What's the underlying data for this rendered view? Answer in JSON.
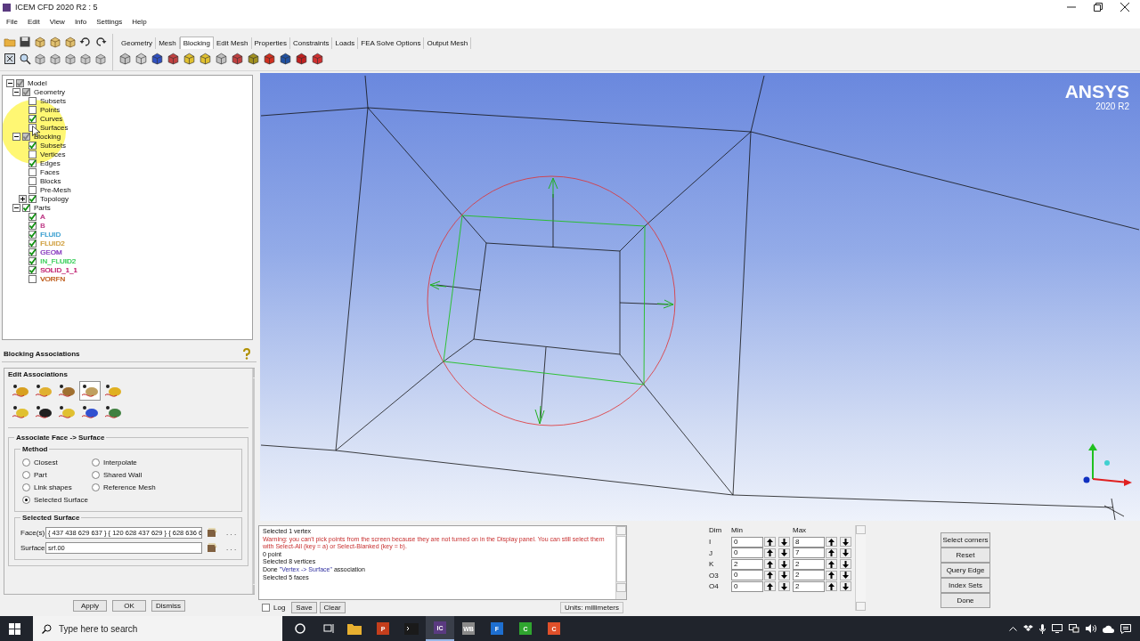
{
  "window": {
    "title": "ICEM CFD 2020 R2 : 5"
  },
  "menu": [
    "File",
    "Edit",
    "View",
    "Info",
    "Settings",
    "Help"
  ],
  "tabs": [
    {
      "label": "Geometry",
      "selected": false
    },
    {
      "label": "Mesh",
      "selected": false
    },
    {
      "label": "Blocking",
      "selected": true
    },
    {
      "label": "Edit Mesh",
      "selected": false
    },
    {
      "label": "Properties",
      "selected": false
    },
    {
      "label": "Constraints",
      "selected": false
    },
    {
      "label": "Loads",
      "selected": false
    },
    {
      "label": "FEA Solve Options",
      "selected": false
    },
    {
      "label": "Output Mesh",
      "selected": false
    }
  ],
  "tree": [
    {
      "label": "Model",
      "checked": true,
      "partial": true,
      "expanded": true,
      "children": [
        {
          "label": "Geometry",
          "checked": true,
          "partial": true,
          "expanded": true,
          "children": [
            {
              "label": "Subsets",
              "checked": false,
              "partial": false
            },
            {
              "label": "Points",
              "checked": false,
              "partial": false
            },
            {
              "label": "Curves",
              "checked": true,
              "partial": false
            },
            {
              "label": "Surfaces",
              "checked": false,
              "partial": false
            }
          ]
        },
        {
          "label": "Blocking",
          "checked": true,
          "partial": true,
          "expanded": true,
          "children": [
            {
              "label": "Subsets",
              "checked": true,
              "partial": false
            },
            {
              "label": "Vertices",
              "checked": false,
              "partial": false
            },
            {
              "label": "Edges",
              "checked": true,
              "partial": false
            },
            {
              "label": "Faces",
              "checked": false,
              "partial": false
            },
            {
              "label": "Blocks",
              "checked": false,
              "partial": false
            },
            {
              "label": "Pre-Mesh",
              "checked": false,
              "partial": false
            },
            {
              "label": "Topology",
              "checked": true,
              "partial": false,
              "expanded": false
            }
          ]
        },
        {
          "label": "Parts",
          "checked": true,
          "partial": false,
          "expanded": true,
          "children": [
            {
              "label": "A",
              "checked": true,
              "partial": false,
              "color": "#c0408a"
            },
            {
              "label": "B",
              "checked": true,
              "partial": false,
              "color": "#c0408a"
            },
            {
              "label": "FLUID",
              "checked": true,
              "partial": false,
              "color": "#3a9fd0"
            },
            {
              "label": "FLUID2",
              "checked": true,
              "partial": false,
              "color": "#d0a040"
            },
            {
              "label": "GEOM",
              "checked": true,
              "partial": false,
              "color": "#8a40c0"
            },
            {
              "label": "IN_FLUID2",
              "checked": true,
              "partial": false,
              "color": "#40d060"
            },
            {
              "label": "SOLID_1_1",
              "checked": true,
              "partial": false,
              "color": "#c02070"
            },
            {
              "label": "VORFN",
              "checked": false,
              "partial": false,
              "color": "#c06020"
            }
          ]
        }
      ]
    }
  ],
  "viewport": {
    "brand": "ANSYS",
    "version": "2020 R2"
  },
  "associations": {
    "title": "Blocking Associations",
    "group": "Edit Associations",
    "tools": [
      {
        "selected": false
      },
      {
        "selected": false
      },
      {
        "selected": false
      },
      {
        "selected": true
      },
      {
        "selected": false
      },
      {
        "selected": false
      },
      {
        "selected": false
      },
      {
        "selected": false
      },
      {
        "selected": false
      },
      {
        "selected": false
      }
    ],
    "section": "Associate Face -> Surface",
    "method_title": "Method",
    "methods": [
      {
        "label": "Closest",
        "selected": false
      },
      {
        "label": "Interpolate",
        "selected": false
      },
      {
        "label": "Part",
        "selected": false
      },
      {
        "label": "Shared Wall",
        "selected": false
      },
      {
        "label": "Link shapes",
        "selected": false
      },
      {
        "label": "Reference Mesh",
        "selected": false
      },
      {
        "label": "Selected Surface",
        "selected": true
      }
    ],
    "selected_title": "Selected Surface",
    "fields": [
      {
        "label": "Face(s)",
        "value": "{ 437 438 629 637 } { 120 628 437 629 } { 628 636 6",
        "more": ". . ."
      },
      {
        "label": "Surface",
        "value": "srf.00",
        "more": ". . ."
      }
    ],
    "buttons": [
      "Apply",
      "OK",
      "Dismiss"
    ]
  },
  "messages": {
    "lines": [
      {
        "segments": [
          {
            "text": "Selected 1 vertex",
            "kind": "normal"
          }
        ]
      },
      {
        "segments": [
          {
            "text": "Warning: you can't pick points from the screen because they are not turned on in the Display panel. You can still select them with Select-All (key = a) or Select-Blanked (key = b).",
            "kind": "warning"
          }
        ]
      },
      {
        "segments": [
          {
            "text": "0 point",
            "kind": "normal"
          }
        ]
      },
      {
        "segments": [
          {
            "text": "Selected 8 vertices",
            "kind": "normal"
          }
        ]
      },
      {
        "segments": [
          {
            "text": "Done ",
            "kind": "normal"
          },
          {
            "text": "\"Vertex -> Surface\"",
            "kind": "quoted"
          },
          {
            "text": " association",
            "kind": "normal"
          }
        ]
      },
      {
        "segments": [
          {
            "text": "Selected 5 faces",
            "kind": "normal"
          }
        ]
      }
    ],
    "log": {
      "label": "Log",
      "checked": false
    },
    "buttons": [
      "Save",
      "Clear"
    ],
    "units": "Units: millimeters"
  },
  "dims": {
    "headers": [
      "Dim",
      "Min",
      "Max"
    ],
    "rows": [
      {
        "dim": "I",
        "min": "0",
        "max": "8"
      },
      {
        "dim": "J",
        "min": "0",
        "max": "7"
      },
      {
        "dim": "K",
        "min": "2",
        "max": "2"
      },
      {
        "dim": "O3",
        "min": "0",
        "max": "2"
      },
      {
        "dim": "O4",
        "min": "0",
        "max": "2"
      }
    ]
  },
  "actions": [
    "Select corners",
    "Reset",
    "Query Edge",
    "Index Sets",
    "Done"
  ],
  "taskbar": {
    "search": {
      "placeholder": "Type here to search"
    },
    "apps": [
      {
        "kind": "folder",
        "color": "#e8b030",
        "selected": false
      },
      {
        "kind": "letter",
        "label": "P",
        "color": "#c43e1c",
        "selected": false
      },
      {
        "kind": "terminal",
        "color": "#1a1a1a",
        "selected": false
      },
      {
        "kind": "letter",
        "label": "IC",
        "color": "#5a3a80",
        "selected": true
      },
      {
        "kind": "letter",
        "label": "WB",
        "color": "#8a8a8a",
        "selected": false
      },
      {
        "kind": "letter",
        "label": "F",
        "color": "#1e6fd0",
        "selected": false
      },
      {
        "kind": "letter",
        "label": "C",
        "color": "#2fa52f",
        "selected": false
      },
      {
        "kind": "letter",
        "label": "C",
        "color": "#e0502a",
        "selected": false
      }
    ]
  }
}
